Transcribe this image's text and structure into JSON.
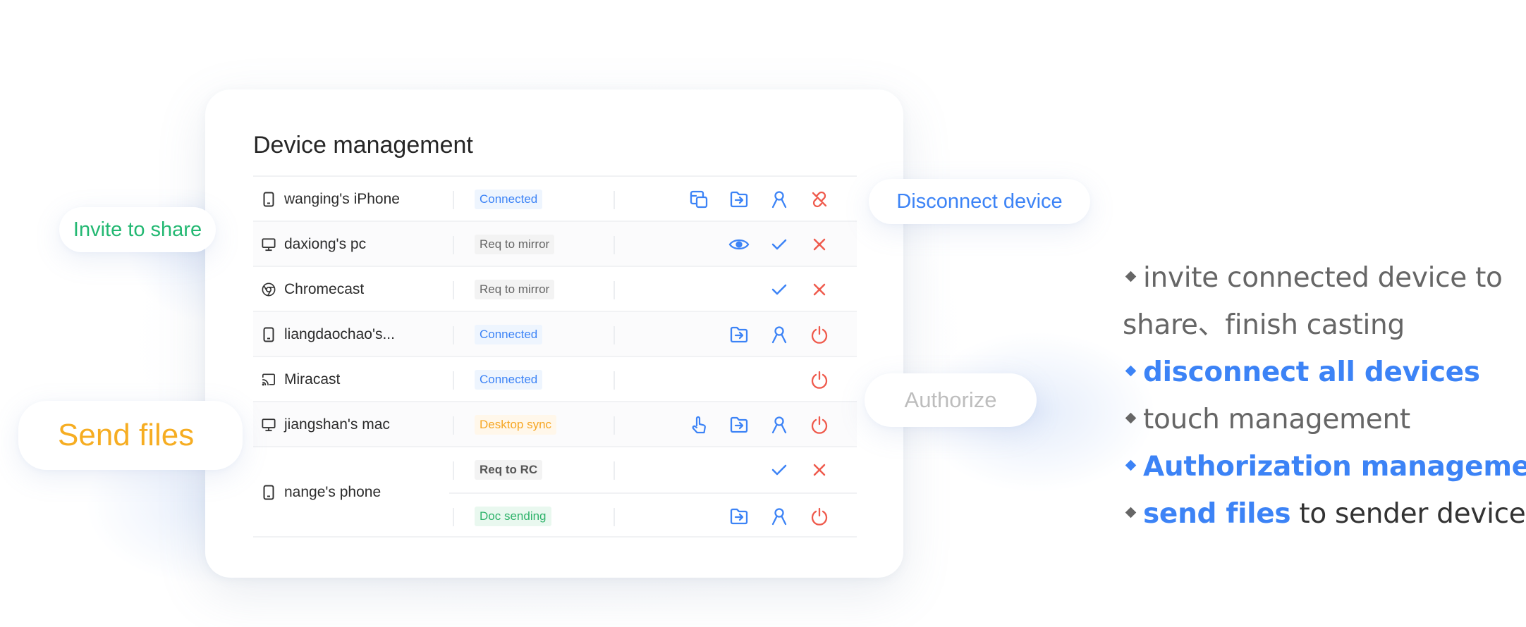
{
  "card": {
    "title": "Device management",
    "rows": [
      {
        "device": "wanging's iPhone",
        "device_icon": "phone-icon",
        "status": "Connected",
        "actions": [
          "screen-share-icon",
          "send-file-icon",
          "authorize-user-icon",
          "disconnect-link-icon"
        ]
      },
      {
        "device": "daxiong's pc",
        "device_icon": "monitor-icon",
        "status": "Req to mirror",
        "actions": [
          "eye-icon",
          "check-icon",
          "close-icon"
        ]
      },
      {
        "device": "Chromecast",
        "device_icon": "chrome-icon",
        "status": "Req to mirror",
        "actions": [
          "check-icon",
          "close-icon"
        ]
      },
      {
        "device": "liangdaochao's...",
        "device_icon": "phone-icon",
        "status": "Connected",
        "actions": [
          "send-file-icon",
          "authorize-user-icon",
          "power-icon"
        ]
      },
      {
        "device": "Miracast",
        "device_icon": "cast-icon",
        "status": "Connected",
        "actions": [
          "power-icon"
        ]
      },
      {
        "device": "jiangshan's mac",
        "device_icon": "monitor-icon",
        "status": "Desktop sync",
        "actions": [
          "touch-icon",
          "send-file-icon",
          "authorize-user-icon",
          "power-icon"
        ]
      },
      {
        "device": "nange's phone",
        "device_icon": "phone-icon",
        "status": "Req to RC",
        "status2": "Doc sending",
        "actions": [
          "check-icon",
          "close-icon"
        ],
        "actions2": [
          "send-file-icon",
          "authorize-user-icon",
          "power-icon"
        ]
      }
    ]
  },
  "callouts": {
    "invite": "Invite to share",
    "disconnect": "Disconnect device",
    "authorize": "Authorize",
    "send_files": "Send files"
  },
  "features": {
    "f1_line1": "invite connected device to",
    "f1_line2": "share、finish casting",
    "f2": "disconnect all devices",
    "f3": "touch management",
    "f4": "Authorization management",
    "f5_highlight": "send files",
    "f5_rest": " to sender devices"
  },
  "colors": {
    "blue": "#3c83f6",
    "red": "#ef5a4c",
    "green": "#23b872",
    "orange": "#f6ad22",
    "gray_text": "#666666"
  }
}
